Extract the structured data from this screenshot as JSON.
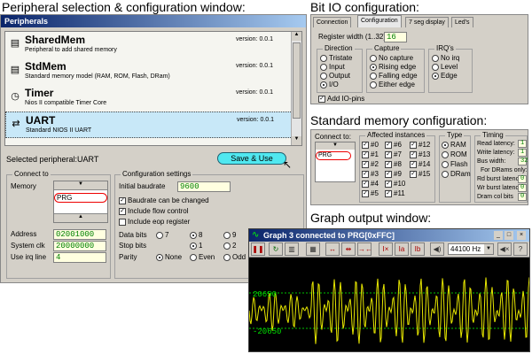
{
  "captions": {
    "peripheral": "Peripheral selection & configuration window:",
    "bitio": "Bit IO configuration:",
    "stdmem": "Standard memory configuration:",
    "graph": "Graph output window:"
  },
  "peripheral_window": {
    "title": "Peripherals",
    "items": [
      {
        "name": "SharedMem",
        "desc": "Peripheral to add shared memory",
        "version": "version: 0.0.1",
        "icon": "chip-icon"
      },
      {
        "name": "StdMem",
        "desc": "Standard memory model (RAM, ROM, Flash, DRam)",
        "version": "version: 0.0.1",
        "icon": "memory-icon"
      },
      {
        "name": "Timer",
        "desc": "Nios II compatible Timer Core",
        "version": "version: 0.0.1",
        "icon": "clock-icon"
      },
      {
        "name": "UART",
        "desc": "Standard NIOS II UART",
        "version": "version: 0.0.1",
        "icon": "arrows-icon"
      }
    ],
    "selected_label": "Selected peripheral:UART",
    "save_button": "Save & Use",
    "connect_to": {
      "title": "Connect to",
      "memory_label": "Memory",
      "memory_value": "PRG",
      "address_label": "Address",
      "address_value": "02001000",
      "sysclk_label": "System clk",
      "sysclk_value": "20000000",
      "irq_label": "Use irq line",
      "irq_value": "4"
    },
    "config": {
      "title": "Configuration settings",
      "baudrate_label": "Initial baudrate",
      "baudrate_value": "9600",
      "checks": [
        {
          "label": "Baudrate can be changed",
          "checked": true
        },
        {
          "label": "Include flow control",
          "checked": true
        },
        {
          "label": "Include eop register",
          "checked": false
        }
      ],
      "databits_label": "Data bits",
      "databits": [
        "7",
        "8",
        "9"
      ],
      "databits_selected": "8",
      "stopbits_label": "Stop bits",
      "stopbits": [
        "1",
        "2"
      ],
      "stopbits_selected": "1",
      "parity_label": "Parity",
      "parity": [
        "None",
        "Even",
        "Odd"
      ],
      "parity_selected": "None"
    }
  },
  "bitio_window": {
    "tabs": [
      "Connection",
      "Configuration",
      "7 seg display",
      "Led's"
    ],
    "active_tab": "Configuration",
    "width_label": "Register width (1..32)",
    "width_value": "16",
    "direction": {
      "title": "Direction",
      "options": [
        "Tristate",
        "Input",
        "Output",
        "I/O"
      ],
      "selected": "I/O"
    },
    "capture": {
      "title": "Capture",
      "options": [
        "No capture",
        "Rising edge",
        "Falling edge",
        "Either edge"
      ],
      "selected": "Rising edge"
    },
    "irq": {
      "title": "IRQ's",
      "options": [
        "No irq",
        "Level",
        "Edge"
      ],
      "selected": "Edge"
    },
    "add_pins_label": "Add IO-pins"
  },
  "stdmem_window": {
    "connect_label": "Connect to:",
    "connect_value": "PRG",
    "affected_title": "Affected instances",
    "instances_col1": [
      "#0",
      "#1",
      "#2",
      "#3",
      "#4",
      "#5"
    ],
    "instances_col2": [
      "#6",
      "#7",
      "#8",
      "#9",
      "#10",
      "#11"
    ],
    "instances_col3": [
      "#12",
      "#13",
      "#14",
      "#15"
    ],
    "type_title": "Type",
    "types": [
      "RAM",
      "ROM",
      "Flash",
      "DRam"
    ],
    "type_selected": "RAM",
    "timing_title": "Timing",
    "timing": [
      {
        "label": "Read latency:",
        "value": "1"
      },
      {
        "label": "Write latency:",
        "value": "1"
      },
      {
        "label": "Bus width:",
        "value": "32"
      }
    ],
    "dram_only": "For DRams only:",
    "dram_timing": [
      {
        "label": "Rd burst latency",
        "value": "0"
      },
      {
        "label": "Wr burst latency",
        "value": "0"
      },
      {
        "label": "Dram col bits",
        "value": "0"
      }
    ]
  },
  "graph_window": {
    "title": "Graph 3 connected to PRG[0xFFC]",
    "sample_rate": "44100 Hz",
    "y_max": "20650",
    "y_min": "-20650",
    "colors": {
      "background": "#000000",
      "wave": "#e8e800",
      "grid": "#00c000"
    }
  }
}
